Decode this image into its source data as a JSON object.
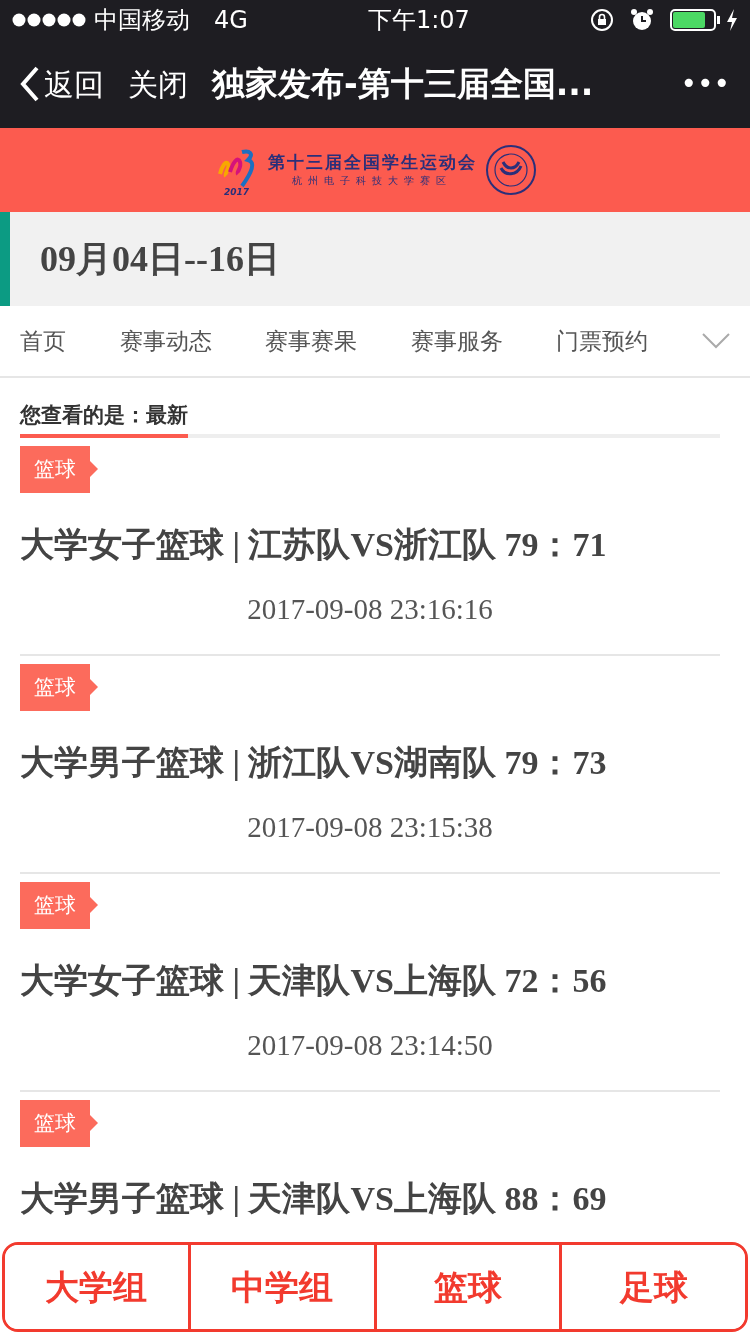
{
  "status_bar": {
    "carrier": "中国移动",
    "network": "4G",
    "time": "下午1:07"
  },
  "nav_bar": {
    "back": "返回",
    "close": "关闭",
    "title": "独家发布-第十三届全国...",
    "more": "•••"
  },
  "banner": {
    "title": "第十三届全国学生运动会",
    "subtitle": "杭州电子科技大学赛区",
    "year": "2017"
  },
  "date_range": "09月04日--16日",
  "tabs": [
    {
      "label": "首页"
    },
    {
      "label": "赛事动态"
    },
    {
      "label": "赛事赛果"
    },
    {
      "label": "赛事服务"
    },
    {
      "label": "门票预约"
    }
  ],
  "filter": {
    "label": "您查看的是：最新"
  },
  "articles": [
    {
      "tag": "篮球",
      "title": "大学女子篮球 | 江苏队VS浙江队 79：71",
      "time": "2017-09-08 23:16:16"
    },
    {
      "tag": "篮球",
      "title": "大学男子篮球 | 浙江队VS湖南队 79：73",
      "time": "2017-09-08 23:15:38"
    },
    {
      "tag": "篮球",
      "title": "大学女子篮球 | 天津队VS上海队 72：56",
      "time": "2017-09-08 23:14:50"
    },
    {
      "tag": "篮球",
      "title": "大学男子篮球 | 天津队VS上海队 88：69"
    }
  ],
  "bottom_tabs": [
    "大学组",
    "中学组",
    "篮球",
    "足球"
  ]
}
